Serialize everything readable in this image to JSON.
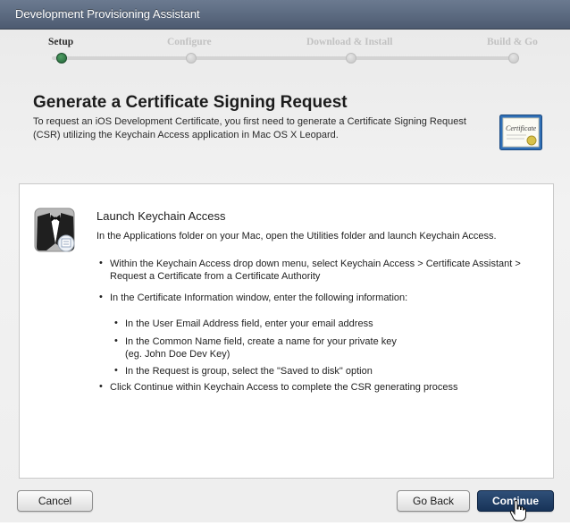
{
  "window": {
    "title": "Development Provisioning Assistant"
  },
  "steps": [
    {
      "label": "Setup",
      "active": true
    },
    {
      "label": "Configure",
      "active": false
    },
    {
      "label": "Download & Install",
      "active": false
    },
    {
      "label": "Build & Go",
      "active": false
    }
  ],
  "header": {
    "title": "Generate a Certificate Signing Request",
    "intro_line1": "To request an iOS Development Certificate, you first need to generate a Certificate Signing Request",
    "intro_line2": "(CSR) utilizing the Keychain Access application in Mac OS X Leopard.",
    "cert_icon": "certificate-icon",
    "cert_icon_text": "Certificate"
  },
  "panel": {
    "icon": "keychain-access-icon",
    "title": "Launch Keychain Access",
    "description": "In the Applications folder on your Mac, open the Utilities folder and launch Keychain Access.",
    "bullet1_line1": "Within the Keychain Access drop down menu, select Keychain Access > Certificate Assistant >",
    "bullet1_line2": "Request a Certificate from a Certificate Authority",
    "bullet2": "In the Certificate Information window, enter the following information:",
    "sub1": "In the User Email Address field, enter your email address",
    "sub2_line1": "In the Common Name field, create a name for your private key",
    "sub2_line2": "(eg. John Doe Dev Key)",
    "sub3": "In the Request is group, select the \"Saved to disk\" option",
    "bullet3": "Click Continue within Keychain Access to complete the CSR generating process"
  },
  "buttons": {
    "cancel": "Cancel",
    "go_back": "Go Back",
    "continue": "Continue"
  },
  "colors": {
    "titlebar": "#5a687e",
    "active_step": "#2f7a45",
    "primary_button": "#1f3d66"
  }
}
